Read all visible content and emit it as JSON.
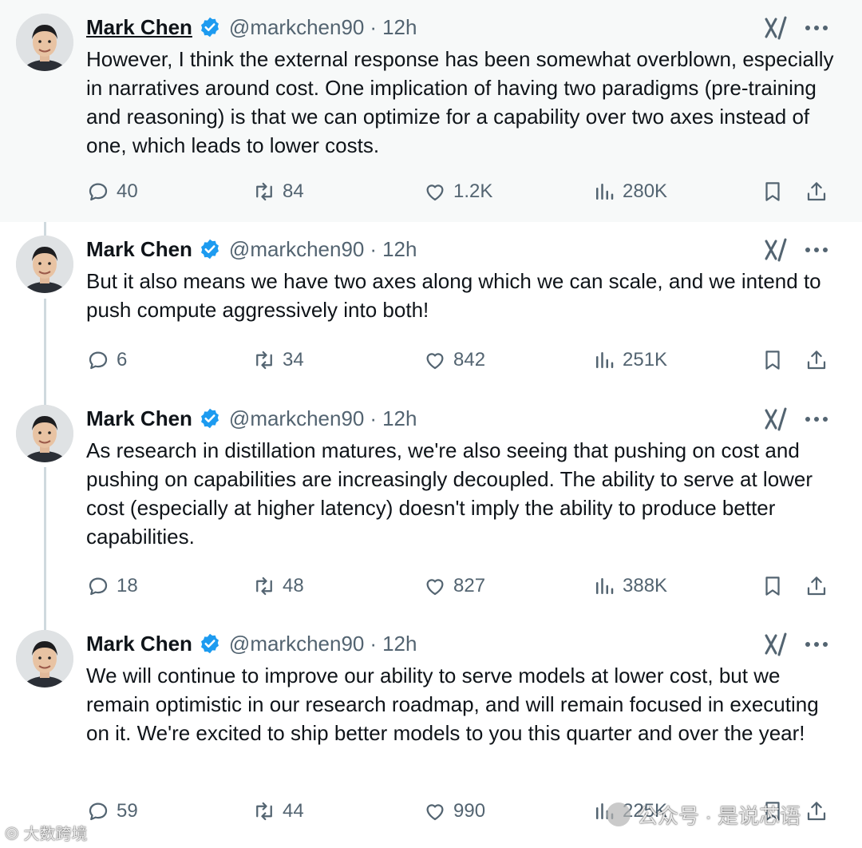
{
  "tweets": [
    {
      "name": "Mark Chen",
      "handle": "@markchen90",
      "separator": "·",
      "time": "12h",
      "text": "However, I think the external response has been somewhat overblown, especially in narratives around cost. One implication of having two paradigms (pre-training and reasoning) is that we can optimize for a capability over two axes instead of one, which leads to lower costs.",
      "replies": "40",
      "reposts": "84",
      "likes": "1.2K",
      "views": "280K"
    },
    {
      "name": "Mark Chen",
      "handle": "@markchen90",
      "separator": "·",
      "time": "12h",
      "text": "But it also means we have two axes along which we can scale, and we intend to push compute aggressively into both!",
      "replies": "6",
      "reposts": "34",
      "likes": "842",
      "views": "251K"
    },
    {
      "name": "Mark Chen",
      "handle": "@markchen90",
      "separator": "·",
      "time": "12h",
      "text": "As research in distillation matures, we're also seeing that pushing on cost and pushing on capabilities are increasingly decoupled. The ability to serve at lower cost (especially at higher latency) doesn't imply the ability to produce better capabilities.",
      "replies": "18",
      "reposts": "48",
      "likes": "827",
      "views": "388K"
    },
    {
      "name": "Mark Chen",
      "handle": "@markchen90",
      "separator": "·",
      "time": "12h",
      "text": "We will continue to improve our ability to serve models at lower cost, but we remain optimistic in our research roadmap, and will remain focused in executing on it. We're excited to ship better models to you this quarter and over the year!",
      "replies": "59",
      "reposts": "44",
      "likes": "990",
      "views": "225K"
    }
  ],
  "icons": {
    "verified": "verified-badge-icon",
    "grok": "grok-icon",
    "more": "more-icon",
    "reply": "reply-icon",
    "repost": "repost-icon",
    "like": "heart-icon",
    "views": "views-icon",
    "bookmark": "bookmark-icon",
    "share": "share-icon"
  },
  "colors": {
    "verified": "#1d9bf0",
    "text": "#0f1419",
    "secondary": "#536471",
    "highlight_bg": "#f7f9f9",
    "thread_line": "#cfd9de"
  },
  "watermarks": {
    "left": "大数跨境",
    "right": "公众号 · 是说芯语"
  }
}
